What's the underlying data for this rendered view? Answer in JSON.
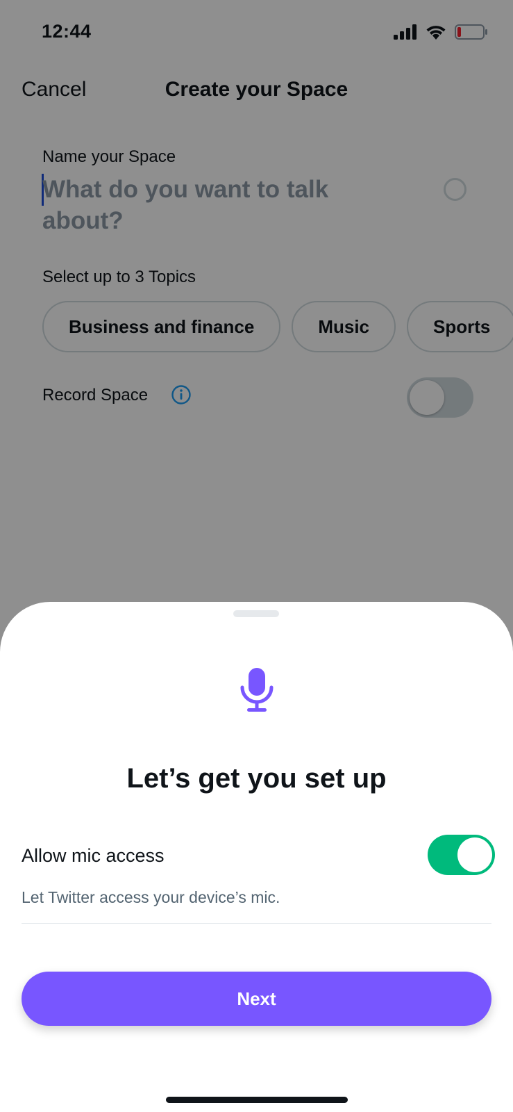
{
  "status_bar": {
    "time": "12:44"
  },
  "nav": {
    "cancel_label": "Cancel",
    "title": "Create your Space"
  },
  "form": {
    "name_label": "Name your Space",
    "name_placeholder": "What do you want to talk about?",
    "topics_label": "Select up to 3 Topics",
    "topics": [
      "Business and finance",
      "Music",
      "Sports"
    ],
    "record_label": "Record Space",
    "record_enabled": false
  },
  "sheet": {
    "icon": "microphone-icon",
    "title": "Let’s get you set up",
    "mic_label": "Allow mic access",
    "mic_description": "Let Twitter access your device’s mic.",
    "mic_enabled": true,
    "next_label": "Next"
  },
  "colors": {
    "accent": "#7856ff",
    "toggle_on": "#00ba7c",
    "info": "#1d9bf0",
    "text_primary": "#0f1419",
    "text_secondary": "#536471"
  }
}
